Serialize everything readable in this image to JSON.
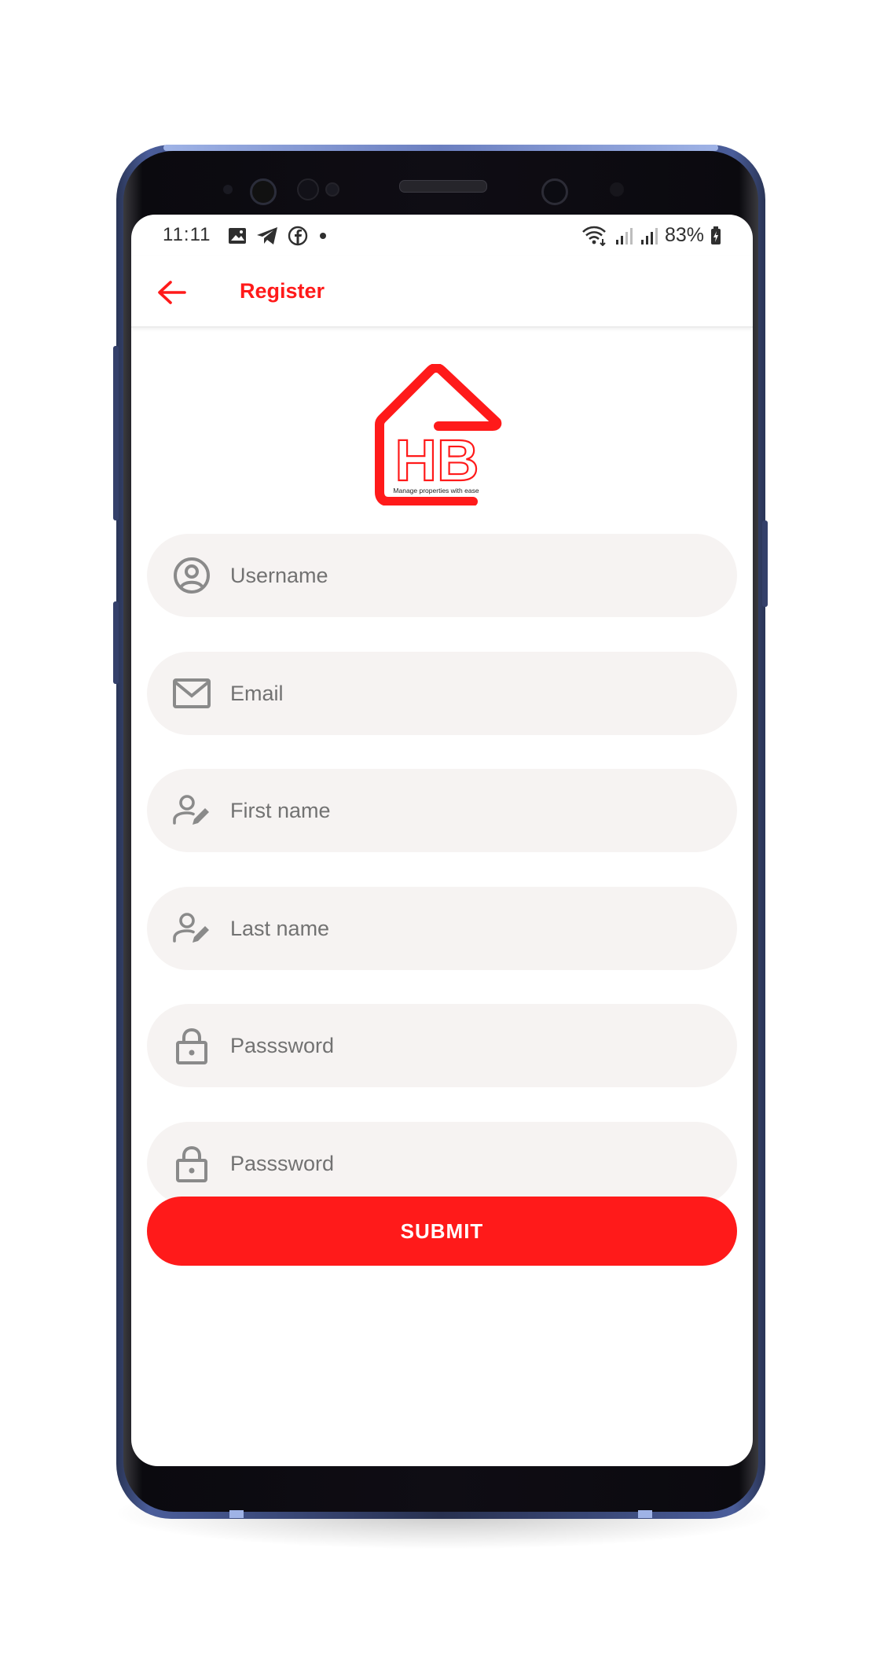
{
  "status_bar": {
    "time": "11:11",
    "battery": "83%",
    "left_icons": [
      "gallery-icon",
      "telegram-icon",
      "facebook-icon",
      "dot-icon"
    ],
    "right_icons": [
      "wifi-icon",
      "signal-icon",
      "signal-icon",
      "battery-icon"
    ]
  },
  "app_bar": {
    "title": "Register",
    "back_icon": "arrow-left-icon"
  },
  "logo": {
    "letters": "HB",
    "tagline": "Manage properties with ease"
  },
  "form": {
    "fields": [
      {
        "placeholder": "Username",
        "value": "",
        "icon": "user-circle-icon"
      },
      {
        "placeholder": "Email",
        "value": "",
        "icon": "mail-icon"
      },
      {
        "placeholder": "First name",
        "value": "",
        "icon": "user-edit-icon"
      },
      {
        "placeholder": "Last name",
        "value": "",
        "icon": "user-edit-icon"
      },
      {
        "placeholder": "Passsword",
        "value": "",
        "icon": "lock-icon"
      },
      {
        "placeholder": "Passsword",
        "value": "",
        "icon": "lock-icon"
      }
    ],
    "submit_label": "SUBMIT"
  },
  "colors": {
    "accent": "#ff1a1a",
    "field_background": "#f6f3f2",
    "icon_gray": "#8a8a8a",
    "placeholder": "#727272"
  }
}
